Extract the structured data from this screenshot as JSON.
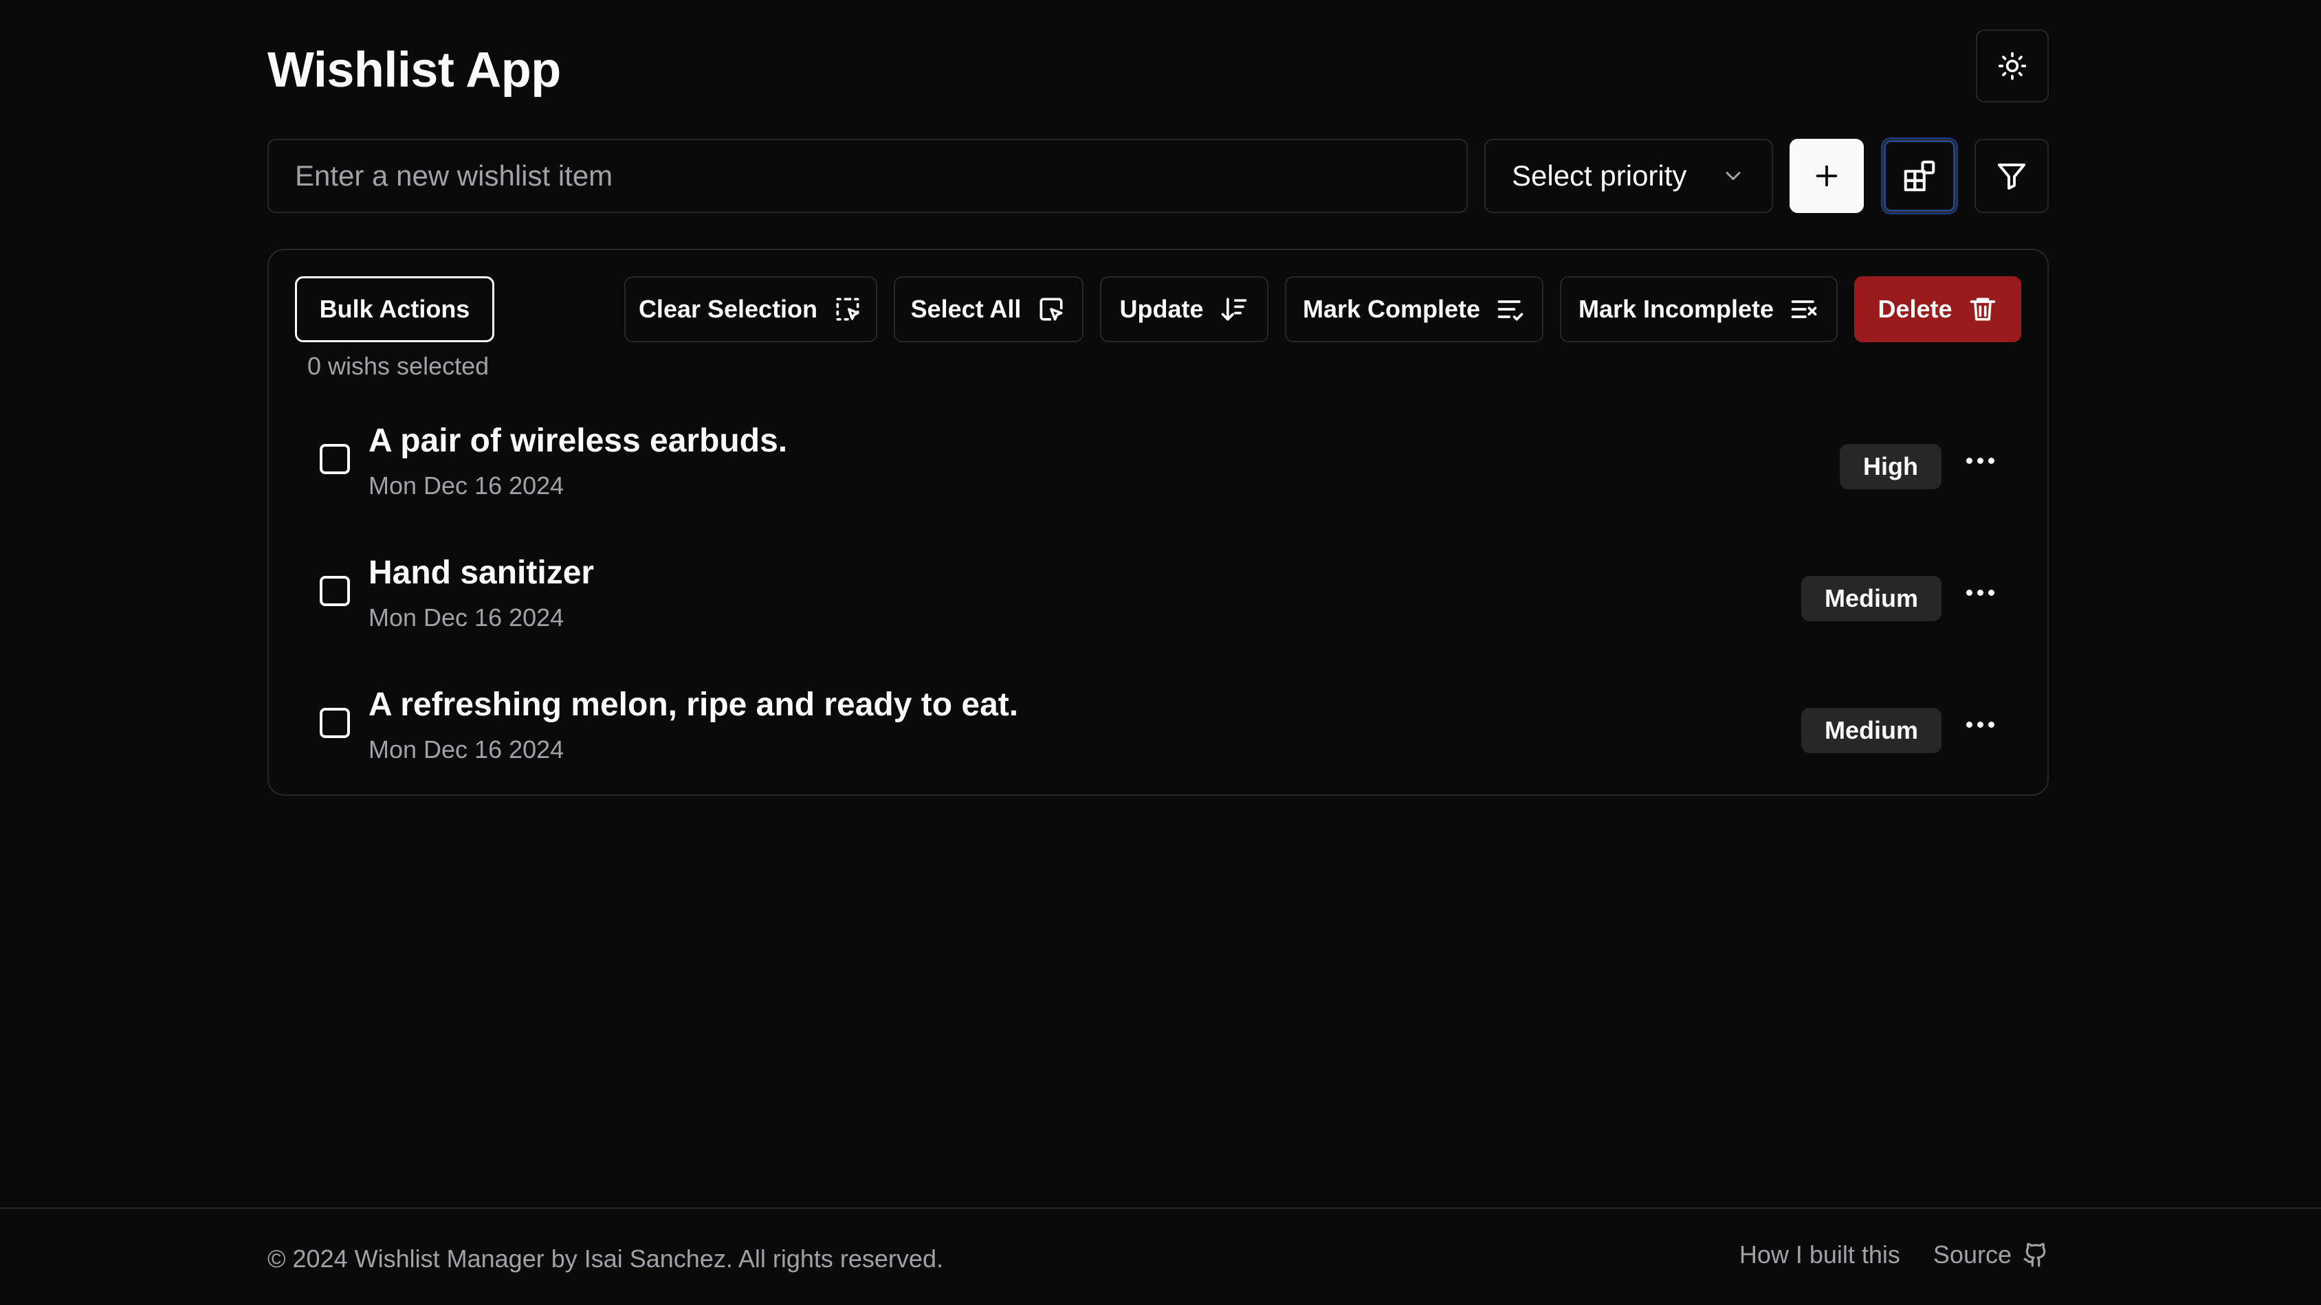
{
  "app": {
    "title": "Wishlist App"
  },
  "toolbar": {
    "input_placeholder": "Enter a new wishlist item",
    "input_value": "",
    "priority_label": "Select priority"
  },
  "bulk": {
    "button_label": "Bulk Actions",
    "selected_text": "0 wishs selected",
    "actions": {
      "clear_selection": "Clear Selection",
      "select_all": "Select All",
      "update": "Update",
      "mark_complete": "Mark Complete",
      "mark_incomplete": "Mark Incomplete",
      "delete": "Delete"
    }
  },
  "items": [
    {
      "title": "A pair of wireless earbuds.",
      "date": "Mon Dec 16 2024",
      "priority": "High",
      "checked": false
    },
    {
      "title": "Hand sanitizer",
      "date": "Mon Dec 16 2024",
      "priority": "Medium",
      "checked": false
    },
    {
      "title": "A refreshing melon, ripe and ready to eat.",
      "date": "Mon Dec 16 2024",
      "priority": "Medium",
      "checked": false
    }
  ],
  "footer": {
    "copyright": "© 2024 Wishlist Manager by Isai Sanchez. All rights reserved.",
    "how_built": "How I built this",
    "source": "Source"
  },
  "colors": {
    "background": "#0a0a0a",
    "border": "#27272a",
    "delete": "#991b1b",
    "muted_text": "#a1a1aa"
  },
  "icons": [
    "sun-icon",
    "chevron-down-icon",
    "plus-icon",
    "layout-icon",
    "filter-icon",
    "dashed-select-icon",
    "cursor-select-icon",
    "sort-icon",
    "list-check-icon",
    "list-x-icon",
    "trash-icon",
    "more-icon",
    "github-icon"
  ]
}
